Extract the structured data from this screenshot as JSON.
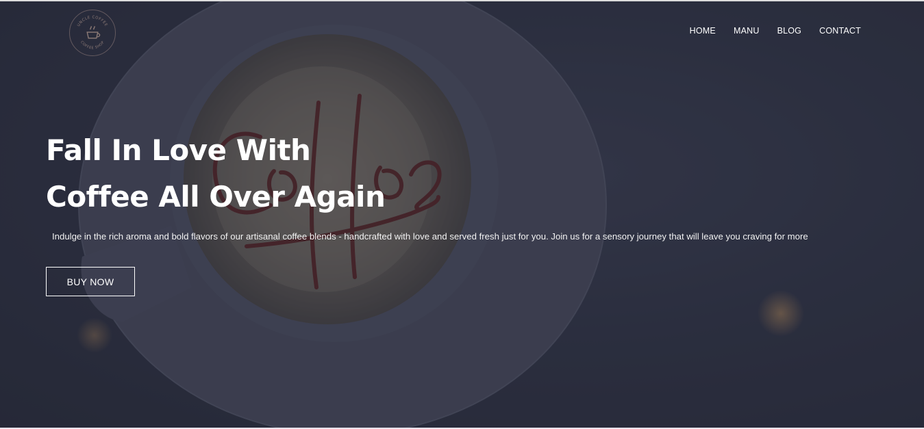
{
  "logo": {
    "text_top": "UNCLE COFFEE",
    "text_bottom": "COFFEE SHOP",
    "icon": "coffee-cup-icon"
  },
  "nav": {
    "items": [
      {
        "label": "HOME"
      },
      {
        "label": "MANU"
      },
      {
        "label": "BLOG"
      },
      {
        "label": "CONTACT"
      }
    ]
  },
  "hero": {
    "title_line1": "Fall In Love With",
    "title_line2": "Coffee All Over Again",
    "subtitle": "Indulge in the rich aroma and bold flavors of our artisanal coffee blends - handcrafted with love and served fresh just for you. Join us for a sensory journey that will leave you craving for more",
    "button_label": "BUY NOW",
    "background_art_text": "Coffee"
  },
  "colors": {
    "overlay": "#2c2f3f",
    "text": "#ffffff",
    "syrup": "#5a1f1f"
  }
}
